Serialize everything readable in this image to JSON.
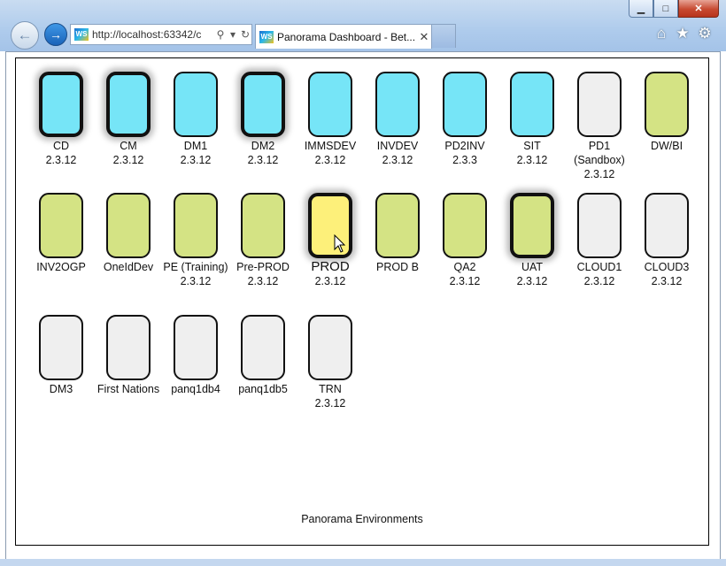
{
  "browser": {
    "url": "http://localhost:63342/c",
    "tab_title": "Panorama Dashboard - Bet...",
    "favicon": "WS",
    "window_buttons": {
      "minimize": "▁",
      "maximize": "□",
      "close": "✕"
    },
    "icons": [
      "back-arrow-icon",
      "forward-arrow-icon",
      "search-icon",
      "dropdown-icon",
      "refresh-icon",
      "home-icon",
      "star-icon",
      "gear-icon",
      "tab-close-icon"
    ]
  },
  "colors": {
    "cyan": "#76e5f7",
    "green": "#d4e384",
    "grey": "#efefef",
    "yellow": "#fdf07a"
  },
  "environments": [
    {
      "name": "CD",
      "version": "2.3.12",
      "color": "cyan",
      "highlight": true
    },
    {
      "name": "CM",
      "version": "2.3.12",
      "color": "cyan",
      "highlight": true
    },
    {
      "name": "DM1",
      "version": "2.3.12",
      "color": "cyan",
      "highlight": false
    },
    {
      "name": "DM2",
      "version": "2.3.12",
      "color": "cyan",
      "highlight": true
    },
    {
      "name": "IMMSDEV",
      "version": "2.3.12",
      "color": "cyan",
      "highlight": false
    },
    {
      "name": "INVDEV",
      "version": "2.3.12",
      "color": "cyan",
      "highlight": false
    },
    {
      "name": "PD2INV",
      "version": "2.3.3",
      "color": "cyan",
      "highlight": false
    },
    {
      "name": "SIT",
      "version": "2.3.12",
      "color": "cyan",
      "highlight": false
    },
    {
      "name": "PD1 (Sandbox)",
      "version": "2.3.12",
      "color": "grey",
      "highlight": false
    },
    {
      "name": "DW/BI",
      "version": "",
      "color": "green",
      "highlight": false
    },
    {
      "name": "INV2OGP",
      "version": "",
      "color": "green",
      "highlight": false
    },
    {
      "name": "OneIdDev",
      "version": "",
      "color": "green",
      "highlight": false
    },
    {
      "name": "PE (Training)",
      "version": "2.3.12",
      "color": "green",
      "highlight": false
    },
    {
      "name": "Pre-PROD",
      "version": "2.3.12",
      "color": "green",
      "highlight": false
    },
    {
      "name": "PROD",
      "version": "2.3.12",
      "color": "yellow",
      "highlight": true,
      "big": true
    },
    {
      "name": "PROD B",
      "version": "",
      "color": "green",
      "highlight": false
    },
    {
      "name": "QA2",
      "version": "2.3.12",
      "color": "green",
      "highlight": false
    },
    {
      "name": "UAT",
      "version": "2.3.12",
      "color": "green",
      "highlight": true
    },
    {
      "name": "CLOUD1",
      "version": "2.3.12",
      "color": "grey",
      "highlight": false
    },
    {
      "name": "CLOUD3",
      "version": "2.3.12",
      "color": "grey",
      "highlight": false
    },
    {
      "name": "DM3",
      "version": "",
      "color": "grey",
      "highlight": false
    },
    {
      "name": "First Nations",
      "version": "",
      "color": "grey",
      "highlight": false
    },
    {
      "name": "panq1db4",
      "version": "",
      "color": "grey",
      "highlight": false
    },
    {
      "name": "panq1db5",
      "version": "",
      "color": "grey",
      "highlight": false
    },
    {
      "name": "TRN",
      "version": "2.3.12",
      "color": "grey",
      "highlight": false
    }
  ],
  "footer": "Panorama Environments"
}
